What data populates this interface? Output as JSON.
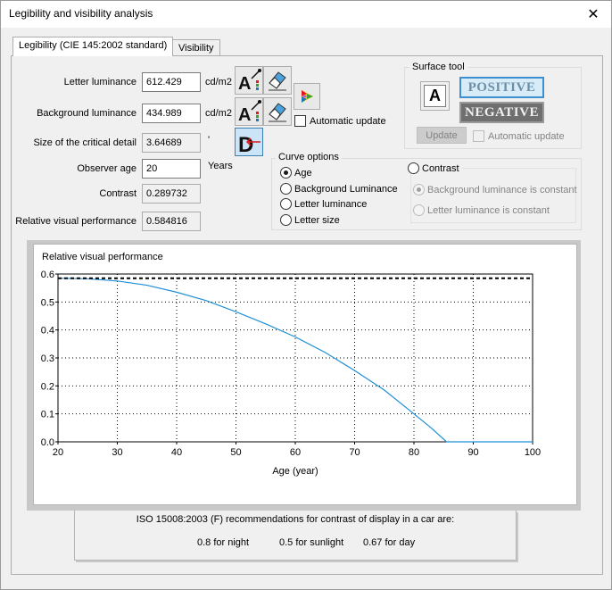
{
  "window": {
    "title": "Legibility and visibility analysis",
    "close_glyph": "✕"
  },
  "tabs": [
    {
      "label": "Legibility (CIE 145:2002 standard)",
      "active": true
    },
    {
      "label": "Visibility",
      "active": false
    }
  ],
  "inputs": {
    "letter_luminance": {
      "label": "Letter luminance",
      "value": "612.429",
      "unit": "cd/m2"
    },
    "background_luminance": {
      "label": "Background luminance",
      "value": "434.989",
      "unit": "cd/m2"
    },
    "critical_detail": {
      "label": "Size of the critical detail",
      "value": "3.64689",
      "unit": "'"
    },
    "observer_age": {
      "label": "Observer age",
      "value": "20",
      "unit": "Years"
    },
    "contrast": {
      "label": "Contrast",
      "value": "0.289732"
    },
    "rvp": {
      "label": "Relative visual performance",
      "value": "0.584816"
    }
  },
  "automatic_update": {
    "label": "Automatic update",
    "checked": false
  },
  "surface_tool": {
    "title": "Surface tool",
    "positive_label": "POSITIVE",
    "negative_label": "NEGATIVE",
    "update_label": "Update",
    "auto_update_label": "Automatic update"
  },
  "curve_options": {
    "title": "Curve options",
    "options": [
      "Age",
      "Background Luminance",
      "Letter luminance",
      "Letter size"
    ],
    "selected": "Age",
    "contrast_label": "Contrast",
    "contrast_sub": [
      "Background luminance is constant",
      "Letter luminance is constant"
    ]
  },
  "chart_data": {
    "type": "line",
    "title": "Relative visual performance",
    "xlabel": "Age (year)",
    "ylabel": "",
    "xlim": [
      20,
      100
    ],
    "ylim": [
      0,
      0.6
    ],
    "xticks": [
      "20",
      "30",
      "40",
      "50",
      "60",
      "70",
      "80",
      "90",
      "100"
    ],
    "yticks": [
      "0.0",
      "0.1",
      "0.2",
      "0.3",
      "0.4",
      "0.5",
      "0.6"
    ],
    "grid": true,
    "series": [
      {
        "style": "solid",
        "color": "#1f8fd6",
        "x": [
          20,
          25,
          30,
          35,
          40,
          45,
          50,
          55,
          60,
          65,
          70,
          75,
          80,
          83,
          85.5,
          90,
          95,
          100
        ],
        "values": [
          0.585,
          0.583,
          0.575,
          0.56,
          0.535,
          0.505,
          0.465,
          0.422,
          0.375,
          0.32,
          0.255,
          0.185,
          0.1,
          0.048,
          0.0,
          0.0,
          0.0,
          0.0
        ]
      },
      {
        "style": "dashed",
        "color": "#000000",
        "x": [
          20,
          100
        ],
        "values": [
          0.585,
          0.585
        ]
      }
    ]
  },
  "iso": {
    "title": "ISO 15008:2003 (F) recommendations for contrast of display in a car are:",
    "night": "0.8 for night",
    "sunlight": "0.5 for sunlight",
    "day": "0.67 for day"
  }
}
